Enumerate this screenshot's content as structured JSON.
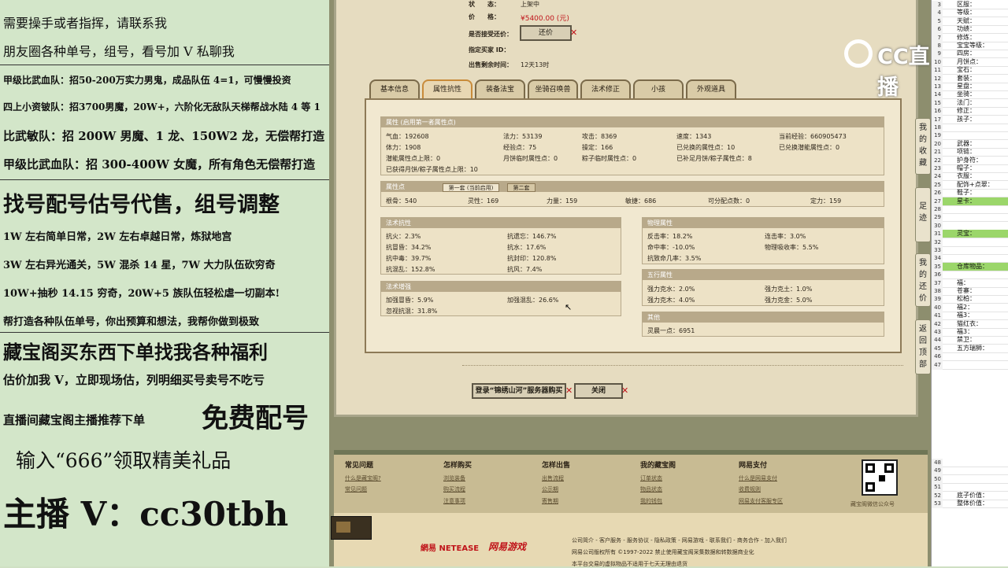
{
  "ads": {
    "l1": "需要操手或者指挥，请联系我",
    "l2": "朋友圈各种单号，组号，看号加 V 私聊我",
    "l3": "甲级比武血队：招50-200万实力男鬼，成品队伍 4=1，可慢慢投资",
    "l4": "四上小资铍队：招3700男魔，20W+，六阶化无敌队天梯帮战水陆 4 等 1",
    "l5": "比武敏队：招 200W 男魔、1 龙、150W2 龙，无偿帮打造",
    "l6": "甲级比武血队：招 300-400W 女魔，所有角色无偿帮打造",
    "l7": "找号配号估号代售，组号调整",
    "l8": "1W 左右简单日常，2W 左右卓越日常，炼狱地宫",
    "l9": "3W 左右异光通关，5W 混杀 14 星，7W 大力队伍砍穷奇",
    "l10": "10W+抽秒 14.15 穷奇，20W+5 族队伍轻松虐一切副本!",
    "l11": "帮打造各种队伍单号，你出预算和想法，我帮你做到极致",
    "l12": "藏宝阁买东西下单找我各种福利",
    "l13": "估价加我 V，立即现场估，列明细买号卖号不吃亏",
    "l14a": "直播间藏宝阁主播推荐下单",
    "l14b": "免费配号",
    "l15": "输入“666”领取精美礼品",
    "l16": "主播 V：cc30tbh"
  },
  "top": {
    "status_label": "状　　态：",
    "status_value": "上架中",
    "price_label": "价　　格：",
    "price_value": "¥5400.00 (元)",
    "bargain_label": "是否接受还价：",
    "bargain_btn": "还价",
    "buyer_label": "指定买家 ID：",
    "buyer_value": "",
    "time_label": "出售剩余时间：",
    "time_value": "12天13时"
  },
  "tabs": [
    "基本信息",
    "属性抗性",
    "装备法宝",
    "坐骑召唤兽",
    "法术修正",
    "小孩",
    "外观道具"
  ],
  "attr": {
    "header": "属性 (启用第一者属性点)",
    "r1": [
      "气血：192608",
      "法力：53139",
      "攻击：8369",
      "速度：1343",
      "当前经验：660905473"
    ],
    "r2": [
      "体力：1908",
      "经验点：75",
      "操定：166",
      "已兑换的属性点：10",
      "已兑换潜能属性点：0"
    ],
    "r3": [
      "潜能属性点上限：0",
      "月饼临时属性点：0",
      "粽子临时属性点：0",
      "已补足月饼/粽子属性点：8"
    ],
    "r4": "已获得月饼/粽子属性点上限：10"
  },
  "points": {
    "header": "属性点",
    "tab1": "第一套 (当前启用)",
    "tab2": "第二套",
    "items": [
      "根骨：540",
      "灵性：169",
      "力量：159",
      "敏捷：686",
      "可分配点数：0",
      "定力：159"
    ]
  },
  "resist": {
    "header": "法术抗性",
    "items": [
      "抗火：2.3%",
      "抗遗忘：146.7%",
      "抗冒昏：34.2%",
      "抗水：17.6%",
      "抗中毒：39.7%",
      "抗封印：120.8%",
      "抗混乱：152.8%",
      "抗风：7.4%"
    ]
  },
  "boost": {
    "header": "法术增强",
    "items": [
      "加强冒昏：5.9%",
      "加强混乱：26.6%",
      "忽视抗混：31.8%"
    ]
  },
  "phys": {
    "header": "物理属性",
    "items": [
      "反击率：18.2%",
      "连击率：3.0%",
      "命中率：-10.0%",
      "物理吸收率：5.5%",
      "抗致命几率：3.5%"
    ]
  },
  "wuxing": {
    "header": "五行属性",
    "items": [
      "强力克水：2.0%",
      "强力克土：1.0%",
      "强力克木：4.0%",
      "强力克金：5.0%"
    ]
  },
  "other": {
    "header": "其他",
    "items": [
      "灵晨一点：6951"
    ]
  },
  "bottom": {
    "login_btn": "登录“锦绣山河”服务器购买",
    "close_btn": "关闭"
  },
  "sidetabs": [
    "我的收藏",
    "足迹",
    "我的还价",
    "返回顶部"
  ],
  "footer": {
    "cols": [
      {
        "title": "常见问题",
        "links": [
          "什么是藏宝阁?",
          "常见问题"
        ]
      },
      {
        "title": "怎样购买",
        "links": [
          "浏览装备",
          "购买流程",
          "注意事项"
        ]
      },
      {
        "title": "怎样出售",
        "links": [
          "出售流程",
          "公示期",
          "寄售期"
        ]
      },
      {
        "title": "我的藏宝阁",
        "links": [
          "订单状态",
          "物品状态",
          "我的钱包"
        ]
      },
      {
        "title": "网易支付",
        "links": [
          "什么是网易支付",
          "收费规则",
          "网易支付客服专区"
        ]
      }
    ],
    "qr_label": "藏宝阁微信公众号",
    "netease": "網易 NETEASE",
    "netease_game": "网易游戏",
    "legal1": "公司简介 - 客户服务 - 服务协议 - 隐私政策 - 网易游戏 - 联系我们 - 商务合作 - 加入我们",
    "legal2": "网易公司版权所有 ©1997-2022 禁止使用藏宝阁采集数据和转数据商业化",
    "legal3": "本平台交易的虚拟物品不适用于七天无理由退货"
  },
  "watermark": "CC直播",
  "sheet": {
    "rows": [
      {
        "n": "3",
        "t": "区服："
      },
      {
        "n": "4",
        "t": "等级："
      },
      {
        "n": "5",
        "t": "天赋："
      },
      {
        "n": "6",
        "t": "功绩："
      },
      {
        "n": "7",
        "t": "修炼："
      },
      {
        "n": "8",
        "t": "宝宝等级："
      },
      {
        "n": "9",
        "t": "四房："
      },
      {
        "n": "10",
        "t": "月饼点："
      },
      {
        "n": "11",
        "t": "宝石："
      },
      {
        "n": "12",
        "t": "套装："
      },
      {
        "n": "13",
        "t": "星盘："
      },
      {
        "n": "14",
        "t": "坐骑："
      },
      {
        "n": "15",
        "t": "法门："
      },
      {
        "n": "16",
        "t": "修正："
      },
      {
        "n": "17",
        "t": "孩子："
      },
      {
        "n": "18",
        "t": ""
      },
      {
        "n": "19",
        "t": ""
      },
      {
        "n": "20",
        "t": "武器："
      },
      {
        "n": "21",
        "t": "项链："
      },
      {
        "n": "22",
        "t": "护身符："
      },
      {
        "n": "23",
        "t": "帽子："
      },
      {
        "n": "24",
        "t": "衣服："
      },
      {
        "n": "25",
        "t": "配饰+点翠："
      },
      {
        "n": "26",
        "t": "鞋子："
      },
      {
        "n": "27",
        "t": "星卡：",
        "hl": true
      },
      {
        "n": "28",
        "t": ""
      },
      {
        "n": "29",
        "t": ""
      },
      {
        "n": "30",
        "t": ""
      },
      {
        "n": "31",
        "t": "灵宝：",
        "hl": true
      },
      {
        "n": "32",
        "t": ""
      },
      {
        "n": "33",
        "t": ""
      },
      {
        "n": "34",
        "t": ""
      },
      {
        "n": "35",
        "t": "仓库物品：",
        "hl": true
      },
      {
        "n": "36",
        "t": ""
      },
      {
        "n": "37",
        "t": "福："
      },
      {
        "n": "38",
        "t": "苍寨："
      },
      {
        "n": "39",
        "t": "松柏："
      },
      {
        "n": "40",
        "t": "福2："
      },
      {
        "n": "41",
        "t": "福3："
      },
      {
        "n": "42",
        "t": "猫红衣："
      },
      {
        "n": "43",
        "t": "福3："
      },
      {
        "n": "44",
        "t": "禁卫："
      },
      {
        "n": "45",
        "t": "五方瑞狮："
      },
      {
        "n": "46",
        "t": ""
      },
      {
        "n": "47",
        "t": ""
      },
      {
        "n": "48",
        "t": ""
      },
      {
        "n": "49",
        "t": ""
      },
      {
        "n": "50",
        "t": ""
      },
      {
        "n": "51",
        "t": ""
      },
      {
        "n": "52",
        "t": "底子价值：",
        "hl": false
      },
      {
        "n": "53",
        "t": "整体价值：",
        "hl": false
      }
    ]
  }
}
